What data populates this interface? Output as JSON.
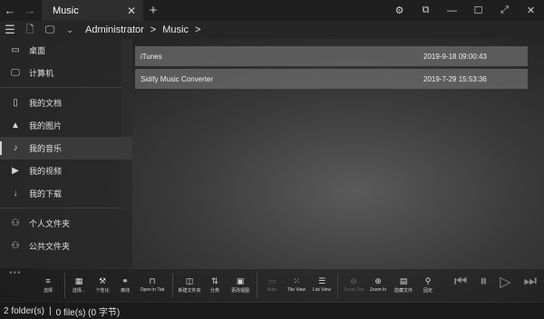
{
  "titlebar": {
    "tab_label": "Music",
    "back_icon": "arrow-left-icon",
    "forward_icon": "arrow-right-icon",
    "close_tab_icon": "close-icon",
    "new_tab_icon": "plus-icon",
    "window_controls": [
      "gear-icon",
      "restore-icon",
      "minimize-icon",
      "maximize-icon",
      "fullscreen-icon",
      "close-icon"
    ]
  },
  "addressbar": {
    "crumbs": [
      "Administrator",
      ">",
      "Music",
      ">"
    ]
  },
  "sidebar": {
    "groups": [
      [
        {
          "label": "桌面",
          "icon": "folder-icon"
        },
        {
          "label": "计算机",
          "icon": "monitor-icon"
        }
      ],
      [
        {
          "label": "我的文档",
          "icon": "document-icon"
        },
        {
          "label": "我的图片",
          "icon": "picture-icon"
        },
        {
          "label": "我的音乐",
          "icon": "music-icon",
          "active": true
        },
        {
          "label": "我的视频",
          "icon": "video-icon"
        },
        {
          "label": "我的下载",
          "icon": "download-icon"
        }
      ],
      [
        {
          "label": "个人文件夹",
          "icon": "user-icon"
        },
        {
          "label": "公共文件夹",
          "icon": "users-icon"
        }
      ]
    ],
    "more": "•••"
  },
  "files": [
    {
      "name": "iTunes",
      "date": "2019-9-18 09:00:43"
    },
    {
      "name": "Sidify Music Converter",
      "date": "2019-7-29 15:53:36"
    }
  ],
  "toolbar": {
    "buttons": [
      {
        "label": "选择",
        "icon": "≡"
      },
      {
        "label": "选择...",
        "icon": "▦"
      },
      {
        "label": "个性化",
        "icon": "⚒"
      },
      {
        "label": "离线",
        "icon": "⚭"
      },
      {
        "label": "Open in Tab",
        "icon": "⊓"
      },
      {
        "label": "新建文件夹",
        "icon": "◫"
      },
      {
        "label": "分类",
        "icon": "⇅"
      },
      {
        "label": "更改视图",
        "icon": "▣"
      },
      {
        "label": "Auto",
        "icon": "▭",
        "disabled": true
      },
      {
        "label": "Tile View",
        "icon": "⁙"
      },
      {
        "label": "List View",
        "icon": "☰"
      },
      {
        "label": "Zoom Out",
        "icon": "⊖",
        "disabled": true
      },
      {
        "label": "Zoom In",
        "icon": "⊕"
      },
      {
        "label": "隐藏文件",
        "icon": "▤"
      },
      {
        "label": "固定",
        "icon": "⚲"
      }
    ],
    "media": [
      "previous-icon",
      "pause-icon",
      "play-icon",
      "next-icon"
    ]
  },
  "status": {
    "folders": "2 folder(s)",
    "files": "0 file(s) (0 字节)"
  }
}
